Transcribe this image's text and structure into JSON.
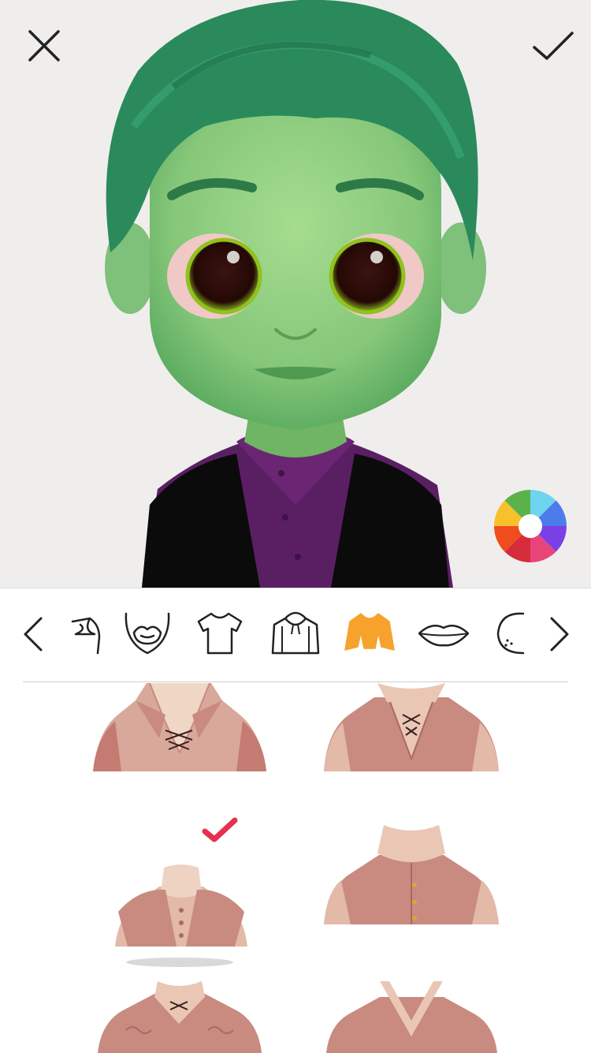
{
  "screen": "avatar-editor",
  "header": {
    "close_label": "Close",
    "confirm_label": "Done"
  },
  "color_picker": {
    "label": "Color",
    "segments": [
      "#6fd4ef",
      "#4d7bea",
      "#7b3fe6",
      "#e8447a",
      "#d62c3b",
      "#f04d1f",
      "#f6c12c",
      "#5bb24a"
    ]
  },
  "category_tabs": [
    {
      "id": "sideburns",
      "icon": "sideburn-icon"
    },
    {
      "id": "beard",
      "icon": "beard-icon"
    },
    {
      "id": "tshirt",
      "icon": "tshirt-icon"
    },
    {
      "id": "hoodie",
      "icon": "hoodie-icon"
    },
    {
      "id": "outerwear",
      "icon": "cape-icon",
      "selected": true
    },
    {
      "id": "lips",
      "icon": "lips-icon"
    },
    {
      "id": "face",
      "icon": "face-icon"
    }
  ],
  "colors": {
    "accent": "#f6a22d",
    "check": "#e5304f",
    "avatar_skin": "#86c77a",
    "avatar_hair": "#2e8a5e",
    "clothing": "#c98a80"
  },
  "outfits": [
    {
      "id": "lace-collar-vest",
      "selected": false
    },
    {
      "id": "laced-tunic",
      "selected": false
    },
    {
      "id": "buttoned-vest",
      "selected": true
    },
    {
      "id": "high-collar-jerkin",
      "selected": false
    },
    {
      "id": "embroidered-vest",
      "selected": false
    },
    {
      "id": "v-neck-robe",
      "selected": false
    }
  ]
}
